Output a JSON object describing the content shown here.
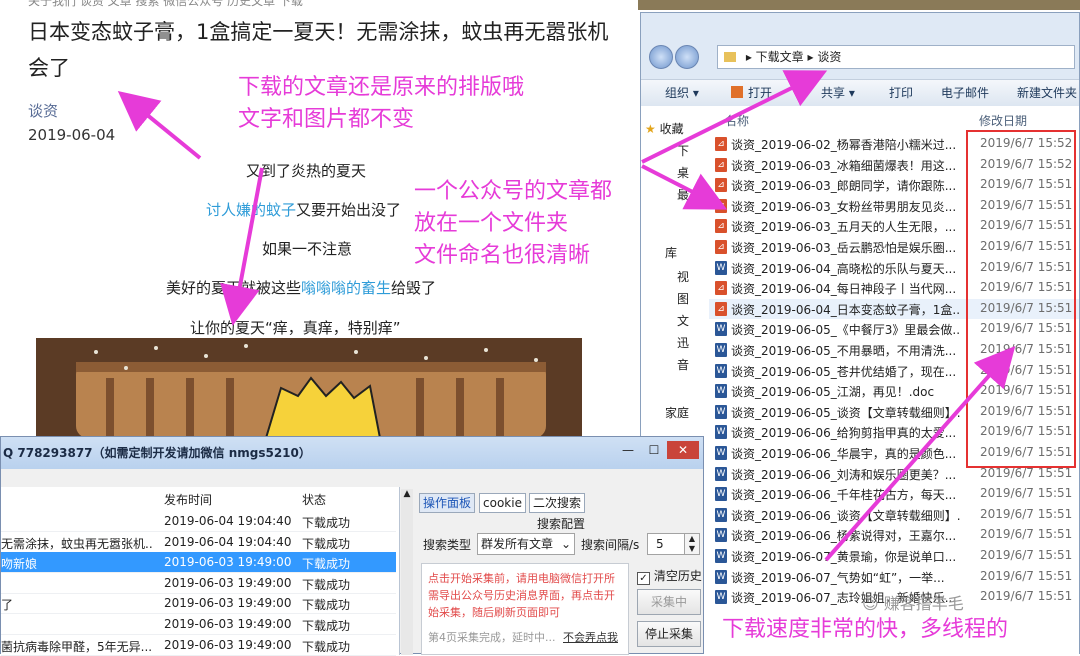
{
  "article": {
    "top_fragment": "关于我们 谈资 文章 搜索 微信公众号 历史文章 下载",
    "title": "日本变态蚊子膏，1盒搞定一夏天！无需涂抹，蚊虫再无嚣张机会了",
    "author": "谈资",
    "date": "2019-06-04",
    "lines": [
      {
        "pre": "又到了炎热的夏天",
        "hl": "",
        "post": ""
      },
      {
        "pre": "",
        "hl": "讨人嫌的蚊子",
        "post": "又要开始出没了"
      },
      {
        "pre": "如果一不注意",
        "hl": "",
        "post": ""
      },
      {
        "pre": "美好的夏天就被这些",
        "hl": "嗡嗡嗡的畜生",
        "post": "给毁了"
      },
      {
        "pre": "让你的夏天“痒，真痒，特别痒”",
        "hl": "",
        "post": ""
      }
    ]
  },
  "explorer": {
    "breadcrumb": [
      "下载文章",
      "谈资"
    ],
    "toolbar": [
      "组织 ▾",
      "打开",
      "共享 ▾",
      "打印",
      "电子邮件",
      "新建文件夹"
    ],
    "nav": [
      "收藏",
      "下",
      "桌",
      "最",
      "库",
      "视",
      "图",
      "文",
      "迅",
      "音",
      "家庭"
    ],
    "columns": {
      "name": "名称",
      "date": "修改日期"
    },
    "files": [
      {
        "name": "谈资_2019-06-02_杨幂香港陪小糯米过...",
        "date": "2019/6/7 15:52",
        "type": "pdf"
      },
      {
        "name": "谈资_2019-06-03_冰箱细菌爆表！用这...",
        "date": "2019/6/7 15:52",
        "type": "pdf"
      },
      {
        "name": "谈资_2019-06-03_郎朗同学，请你跟陈...",
        "date": "2019/6/7 15:51",
        "type": "pdf"
      },
      {
        "name": "谈资_2019-06-03_女粉丝带男朋友见炎...",
        "date": "2019/6/7 15:51",
        "type": "pdf"
      },
      {
        "name": "谈资_2019-06-03_五月天的人生无限，...",
        "date": "2019/6/7 15:51",
        "type": "pdf"
      },
      {
        "name": "谈资_2019-06-03_岳云鹏恐怕是娱乐圈...",
        "date": "2019/6/7 15:51",
        "type": "pdf"
      },
      {
        "name": "谈资_2019-06-04_高晓松的乐队与夏天...",
        "date": "2019/6/7 15:51",
        "type": "doc"
      },
      {
        "name": "谈资_2019-06-04_每日神段子丨当代网...",
        "date": "2019/6/7 15:51",
        "type": "pdf"
      },
      {
        "name": "谈资_2019-06-04_日本变态蚊子膏，1盒...",
        "date": "2019/6/7 15:51",
        "type": "pdf"
      },
      {
        "name": "谈资_2019-06-05_《中餐厅3》里最会做...",
        "date": "2019/6/7 15:51",
        "type": "doc"
      },
      {
        "name": "谈资_2019-06-05_不用暴晒，不用清洗...",
        "date": "2019/6/7 15:51",
        "type": "doc"
      },
      {
        "name": "谈资_2019-06-05_苍井优结婚了，现在...",
        "date": "2019/6/7 15:51",
        "type": "doc"
      },
      {
        "name": "谈资_2019-06-05_江湖，再见！.doc",
        "date": "2019/6/7 15:51",
        "type": "doc"
      },
      {
        "name": "谈资_2019-06-05_谈资【文章转载细则】...",
        "date": "2019/6/7 15:51",
        "type": "doc"
      },
      {
        "name": "谈资_2019-06-06_给狗剪指甲真的太爱...",
        "date": "2019/6/7 15:51",
        "type": "doc"
      },
      {
        "name": "谈资_2019-06-06_华晨宇，真的是颜色...",
        "date": "2019/6/7 15:51",
        "type": "doc"
      },
      {
        "name": "谈资_2019-06-06_刘涛和娱乐圈更美？...",
        "date": "2019/6/7 15:51",
        "type": "doc"
      },
      {
        "name": "谈资_2019-06-06_千年桂花古方，每天...",
        "date": "2019/6/7 15:51",
        "type": "doc"
      },
      {
        "name": "谈资_2019-06-06_谈资【文章转载细则】...",
        "date": "2019/6/7 15:51",
        "type": "doc"
      },
      {
        "name": "谈资_2019-06-06_杨紫说得对，王嘉尔...",
        "date": "2019/6/7 15:51",
        "type": "doc"
      },
      {
        "name": "谈资_2019-06-07_黄景瑜，你是说单口...",
        "date": "2019/6/7 15:51",
        "type": "doc"
      },
      {
        "name": "谈资_2019-06-07_气势如“虹”，一举...",
        "date": "2019/6/7 15:51",
        "type": "doc"
      },
      {
        "name": "谈资_2019-06-07_志玲姐姐，新婚快乐...",
        "date": "2019/6/7 15:51",
        "type": "doc"
      }
    ]
  },
  "downloader": {
    "title": "Q 778293877（如需定制开发请加微信 nmgs5210）",
    "window_buttons": [
      "—",
      "☐",
      "✕"
    ],
    "columns": [
      "发布时间",
      "状态"
    ],
    "rows": [
      {
        "title": "",
        "time": "2019-06-04 19:04:40",
        "status": "下载成功",
        "selected": false
      },
      {
        "title": "无需涂抹，蚊虫再无嚣张机...",
        "time": "2019-06-04 19:04:40",
        "status": "下载成功",
        "selected": false
      },
      {
        "title": "吻新娘",
        "time": "2019-06-03 19:49:00",
        "status": "下载成功",
        "selected": true
      },
      {
        "title": "",
        "time": "2019-06-03 19:49:00",
        "status": "下载成功",
        "selected": false
      },
      {
        "title": "了",
        "time": "2019-06-03 19:49:00",
        "status": "下载成功",
        "selected": false
      },
      {
        "title": "",
        "time": "2019-06-03 19:49:00",
        "status": "下载成功",
        "selected": false
      },
      {
        "title": "菌抗病毒除甲醛，5年无异...",
        "time": "2019-06-03 19:49:00",
        "status": "下载成功",
        "selected": false
      }
    ],
    "tabs": [
      "操作面板",
      "cookie",
      "二次搜索"
    ],
    "section_title": "搜索配置",
    "search_type_label": "搜索类型",
    "search_type_value": "群发所有文章",
    "interval_label": "搜索间隔/s",
    "interval_value": "5",
    "message": "点击开始采集前，请用电脑微信打开所需导出公众号历史消息界面，再点击开始采集，随后刷新页面即可",
    "status_text": "第4页采集完成，延时中...",
    "status_link": "不会弄点我",
    "clear_history": "清空历史",
    "btn_collecting": "采集中",
    "btn_stop": "停止采集"
  },
  "annotations": {
    "note1": [
      "下载的文章还是原来的排版哦",
      "文字和图片都不变"
    ],
    "note2": [
      "一个公众号的文章都",
      "放在一个文件夹",
      "文件命名也很清晰"
    ],
    "note3": "下载速度非常的快，多线程的",
    "watermark": "赚客撸羊毛",
    "color": "#e63bd8"
  }
}
